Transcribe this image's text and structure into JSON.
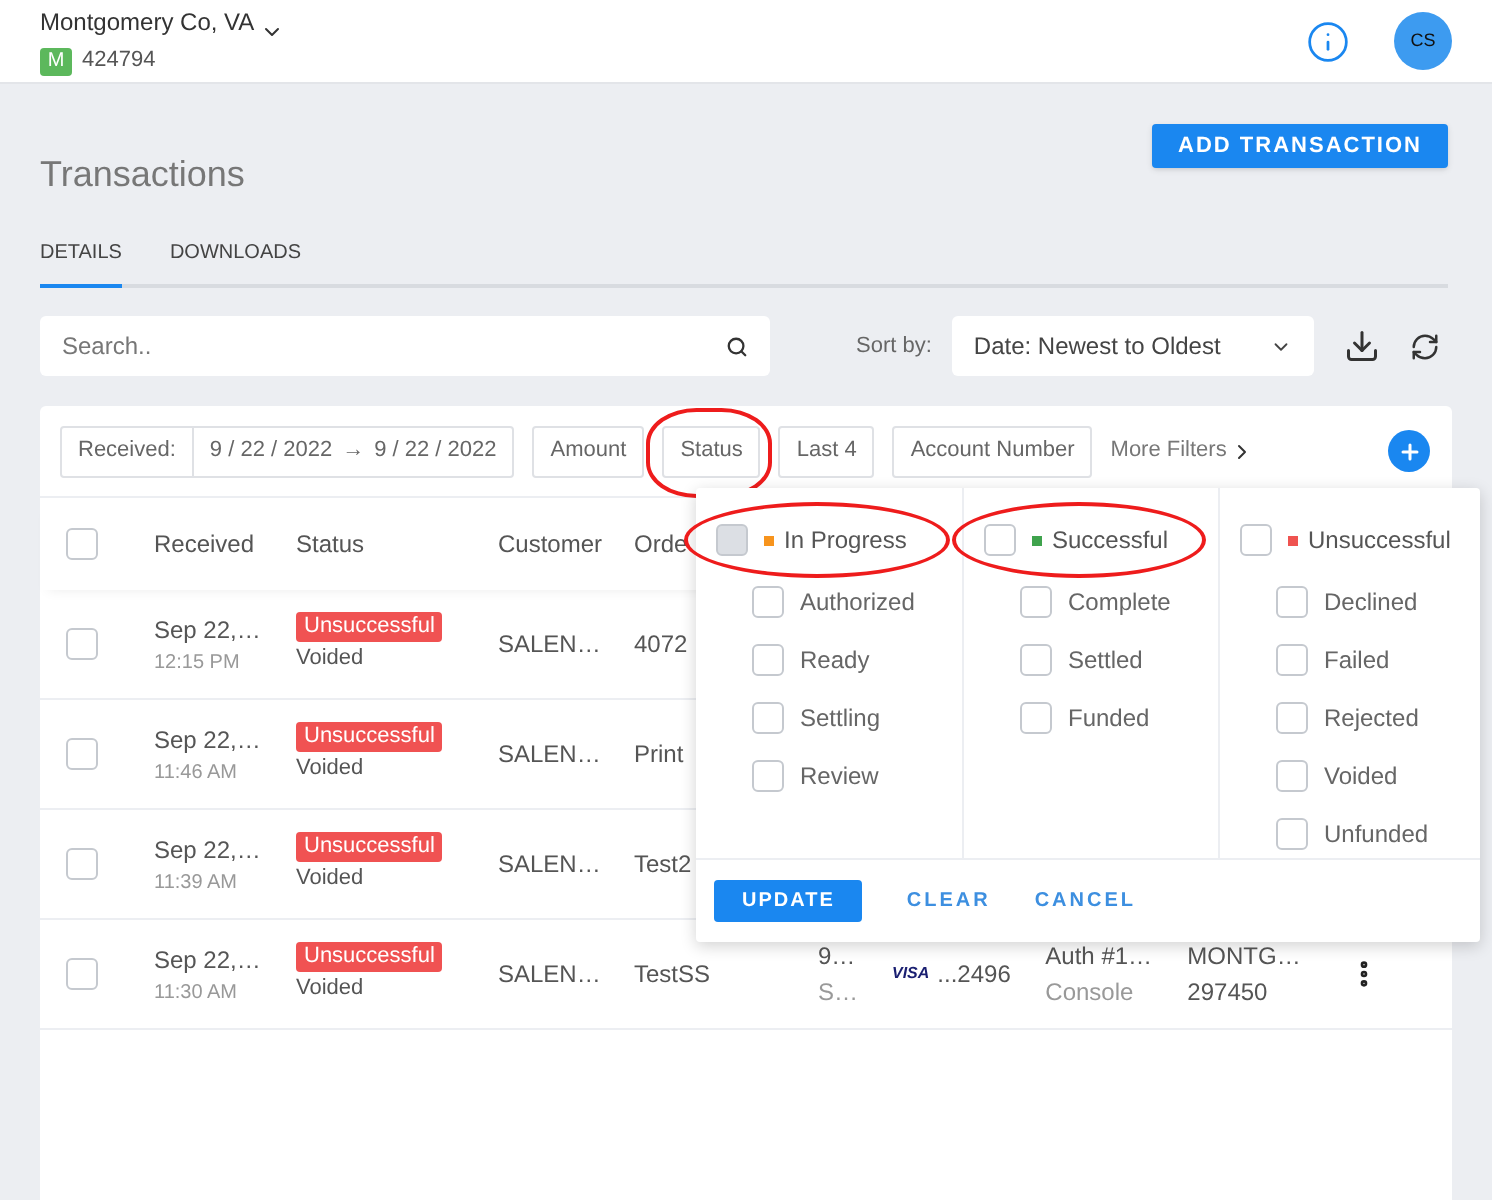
{
  "header": {
    "org": "Montgomery Co, VA",
    "badge": "M",
    "account": "424794",
    "avatar": "CS"
  },
  "page": {
    "title": "Transactions",
    "add_button": "ADD TRANSACTION"
  },
  "tabs": [
    {
      "label": "DETAILS",
      "selected": true
    },
    {
      "label": "DOWNLOADS",
      "selected": false
    }
  ],
  "search": {
    "placeholder": "Search.."
  },
  "sort": {
    "label": "Sort by:",
    "value": "Date: Newest to Oldest"
  },
  "filters": {
    "received_label": "Received:",
    "date_from": "9 / 22 / 2022",
    "arrow": "→",
    "date_to": "9 / 22 / 2022",
    "more": "More Filters",
    "buttons": [
      {
        "label": "Amount",
        "circled": false
      },
      {
        "label": "Status",
        "circled": true
      },
      {
        "label": "Last 4",
        "circled": false
      },
      {
        "label": "Account Number",
        "circled": false
      }
    ]
  },
  "table": {
    "all_checked": false,
    "columns": [
      "Received",
      "Status",
      "Customer",
      "Orde"
    ],
    "rows": [
      {
        "checked": false,
        "date": "Sep 22,…",
        "time": "12:15 PM",
        "status": "Unsuccessful",
        "substatus": "Voided",
        "customer": "SALEN…",
        "order": "4072"
      },
      {
        "checked": false,
        "date": "Sep 22,…",
        "time": "11:46 AM",
        "status": "Unsuccessful",
        "substatus": "Voided",
        "customer": "SALEN…",
        "order": "Print"
      },
      {
        "checked": false,
        "date": "Sep 22,…",
        "time": "11:39 AM",
        "status": "Unsuccessful",
        "substatus": "Voided",
        "customer": "SALEN…",
        "order": "Test2"
      },
      {
        "checked": false,
        "date": "Sep 22,…",
        "time": "11:30 AM",
        "status": "Unsuccessful",
        "substatus": "Voided",
        "customer": "SALEN…",
        "order": "TestSS",
        "extra": {
          "column_6": "9…",
          "column_6_sub": "S…",
          "card_brand": "VISA",
          "last4": "...2496",
          "column_8": "Auth #1…",
          "column_8_sub": "Console",
          "column_9": "MONTG…",
          "column_9_sub": "297450"
        }
      }
    ]
  },
  "status_menu": {
    "groups": [
      {
        "label": "In Progress",
        "color": "#f7941d",
        "checked": false,
        "highlighted": true,
        "circled": true,
        "children": [
          {
            "label": "Authorized",
            "checked": false
          },
          {
            "label": "Ready",
            "checked": false
          },
          {
            "label": "Settling",
            "checked": false
          },
          {
            "label": "Review",
            "checked": false
          }
        ]
      },
      {
        "label": "Successful",
        "color": "#3fa34d",
        "checked": false,
        "highlighted": false,
        "circled": true,
        "children": [
          {
            "label": "Complete",
            "checked": false
          },
          {
            "label": "Settled",
            "checked": false
          },
          {
            "label": "Funded",
            "checked": false
          }
        ]
      },
      {
        "label": "Unsuccessful",
        "color": "#ef5350",
        "checked": false,
        "highlighted": false,
        "circled": false,
        "children": [
          {
            "label": "Declined",
            "checked": false
          },
          {
            "label": "Failed",
            "checked": false
          },
          {
            "label": "Rejected",
            "checked": false
          },
          {
            "label": "Voided",
            "checked": false
          },
          {
            "label": "Unfunded",
            "checked": false
          }
        ]
      }
    ],
    "update": "UPDATE",
    "clear": "CLEAR",
    "cancel": "CANCEL"
  }
}
